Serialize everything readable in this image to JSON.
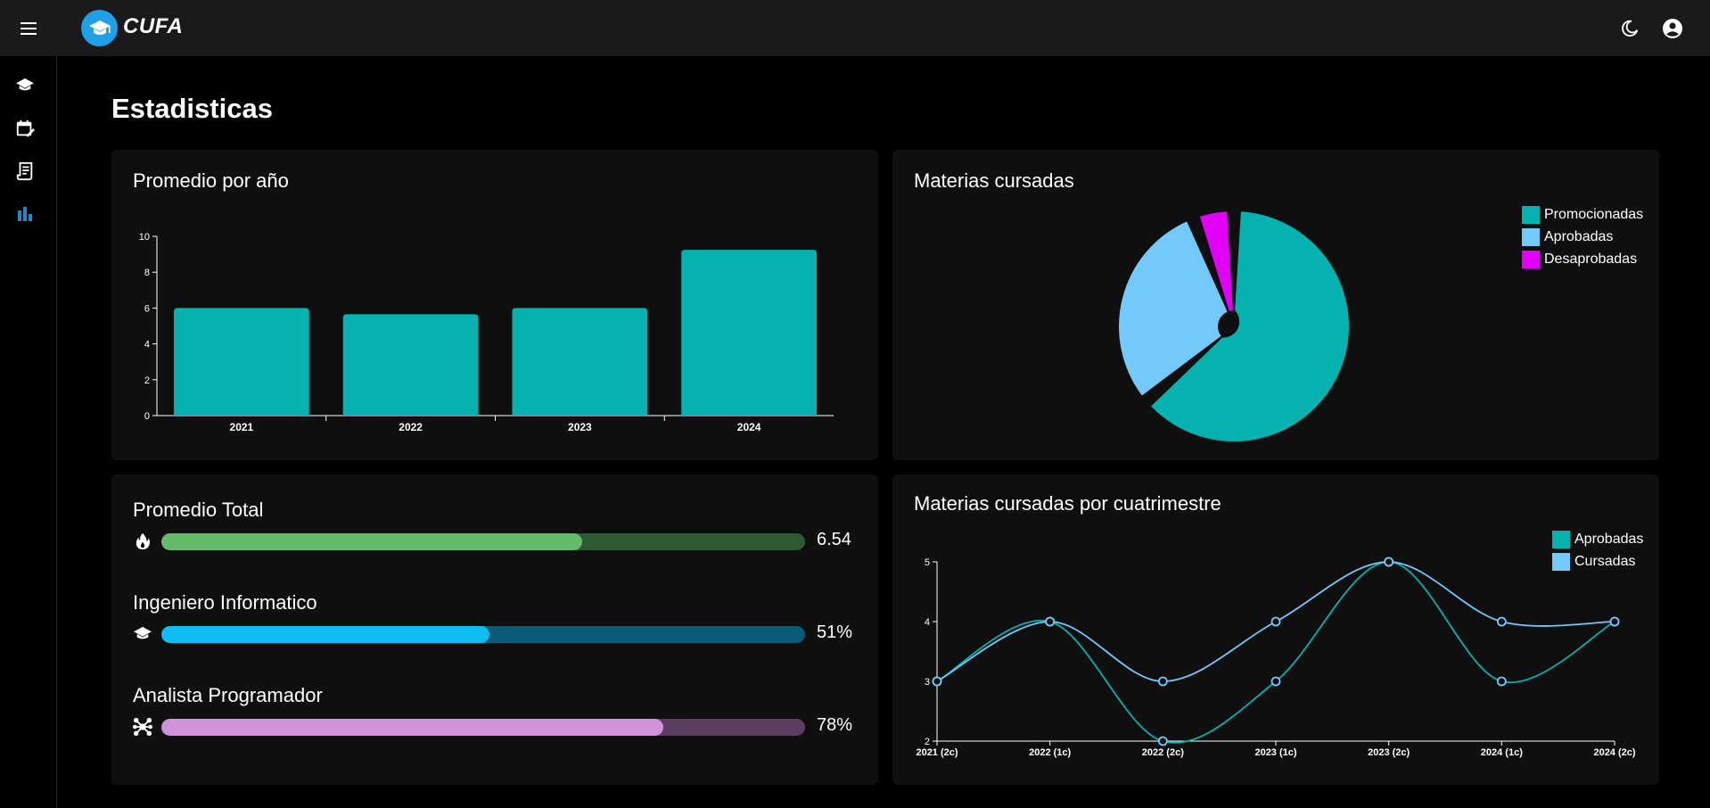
{
  "app": {
    "brand": "CUFA"
  },
  "page": {
    "title": "Estadisticas"
  },
  "colors": {
    "teal": "#05b2b0",
    "lightblue": "#74c9fb",
    "magenta": "#df00f5",
    "green_fill": "#66bb6a",
    "green_track": "#2e5a32",
    "blue_fill": "#0fbdf2",
    "blue_track": "#0a5a78",
    "purple_fill": "#cf93d9",
    "purple_track": "#5b3e62"
  },
  "icons": {
    "menu": "menu-icon",
    "logo": "graduation-cap-icon",
    "theme": "moon-icon",
    "account": "account-circle-icon",
    "sidebar": [
      "school-icon",
      "calendar-edit-icon",
      "receipt-icon",
      "bar-chart-icon"
    ]
  },
  "cards": {
    "avg_year": {
      "title": "Promedio por año"
    },
    "pie": {
      "title": "Materias cursadas"
    },
    "progress": {
      "items": [
        {
          "label": "Promedio Total",
          "value": "6.54",
          "fraction": 0.654,
          "icon": "fire-icon"
        },
        {
          "label": "Ingeniero Informatico",
          "value": "51%",
          "fraction": 0.51,
          "icon": "school-icon"
        },
        {
          "label": "Analista Programador",
          "value": "78%",
          "fraction": 0.78,
          "icon": "hub-icon"
        }
      ]
    },
    "line": {
      "title": "Materias cursadas por cuatrimestre"
    }
  },
  "chart_data": [
    {
      "type": "bar",
      "title": "Promedio por año",
      "categories": [
        "2021",
        "2022",
        "2023",
        "2024"
      ],
      "values": [
        6.0,
        5.65,
        6.0,
        9.25
      ],
      "ylim": [
        0,
        10
      ],
      "yticks": [
        0,
        2,
        4,
        6,
        8,
        10
      ],
      "color": "#05b2b0"
    },
    {
      "type": "pie",
      "title": "Materias cursadas",
      "labels": [
        "Promocionadas",
        "Aprobadas",
        "Desaprobadas"
      ],
      "values": [
        65,
        30,
        4
      ],
      "colors": [
        "#05b2b0",
        "#74c9fb",
        "#df00f5"
      ],
      "legend": "top-right"
    },
    {
      "type": "line",
      "title": "Materias cursadas por cuatrimestre",
      "x": [
        "2021 (2c)",
        "2022 (1c)",
        "2022 (2c)",
        "2023 (1c)",
        "2023 (2c)",
        "2024 (1c)",
        "2024 (2c)"
      ],
      "series": [
        {
          "name": "Aprobadas",
          "values": [
            3,
            4,
            2,
            3,
            5,
            3,
            4
          ],
          "color": "#05b2b0"
        },
        {
          "name": "Cursadas",
          "values": [
            3,
            4,
            3,
            4,
            5,
            4,
            4
          ],
          "color": "#74c9fb"
        }
      ],
      "ylim": [
        2,
        5
      ],
      "yticks": [
        2,
        3,
        4,
        5
      ],
      "legend": "top-right"
    }
  ]
}
